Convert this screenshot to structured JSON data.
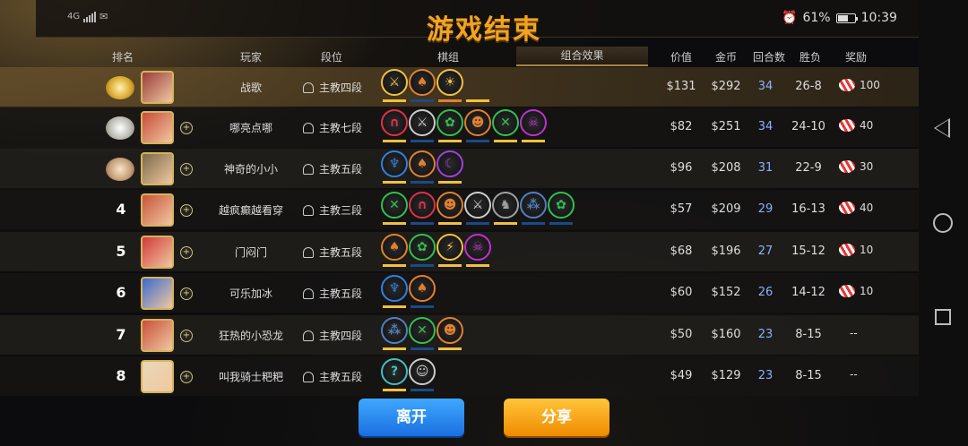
{
  "status": {
    "network": "4G",
    "battery": "61%",
    "battery_level": 0.61,
    "time": "10:39"
  },
  "title": "游戏结束",
  "headers": {
    "rank": "排名",
    "player": "玩家",
    "tier": "段位",
    "board": "棋组",
    "combo": "组合效果",
    "value": "价值",
    "gold": "金币",
    "rounds": "回合数",
    "wl": "胜负",
    "reward": "奖励"
  },
  "players": [
    {
      "rank": "1",
      "medal": "gold",
      "name": "战歌",
      "tier": "主教四段",
      "value": "$131",
      "gold": "$292",
      "rounds": "34",
      "wl": "26-8",
      "reward": "100",
      "me": true,
      "traits": [
        [
          "⚔",
          "#f0c040"
        ],
        [
          "♠",
          "#e08030"
        ],
        [
          "☀",
          "#f0c040"
        ]
      ],
      "bars": [
        "#f0c040",
        "#1a4a8a",
        "#e08030",
        "#f0c040"
      ]
    },
    {
      "rank": "2",
      "medal": "silver",
      "name": "哪亮点哪",
      "tier": "主教七段",
      "value": "$82",
      "gold": "$251",
      "rounds": "34",
      "wl": "24-10",
      "reward": "40",
      "me": false,
      "traits": [
        [
          "∩",
          "#e0304a"
        ],
        [
          "⚔",
          "#cccccc"
        ],
        [
          "✿",
          "#30c050"
        ],
        [
          "☻",
          "#e08030"
        ],
        [
          "✕",
          "#30c050"
        ],
        [
          "☠",
          "#c030d0"
        ]
      ],
      "bars": [
        "#f0c040",
        "#1a4a8a",
        "#f0c040",
        "#1a4a8a",
        "#f0c040",
        "#f0c040"
      ]
    },
    {
      "rank": "3",
      "medal": "bronze",
      "name": "神奇的小小",
      "tier": "主教五段",
      "value": "$96",
      "gold": "$208",
      "rounds": "31",
      "wl": "22-9",
      "reward": "30",
      "me": false,
      "traits": [
        [
          "♆",
          "#3080e0"
        ],
        [
          "♠",
          "#e08030"
        ],
        [
          "☾",
          "#a040e0"
        ]
      ],
      "bars": [
        "#f0c040",
        "#1a4a8a",
        "#f0c040"
      ]
    },
    {
      "rank": "4",
      "medal": "",
      "name": "越疯癫越看穿",
      "tier": "主教三段",
      "value": "$57",
      "gold": "$209",
      "rounds": "29",
      "wl": "16-13",
      "reward": "40",
      "me": false,
      "traits": [
        [
          "✕",
          "#30c050"
        ],
        [
          "∩",
          "#e0304a"
        ],
        [
          "☻",
          "#e08030"
        ],
        [
          "⚔",
          "#cccccc"
        ],
        [
          "♞",
          "#a0a0a0"
        ],
        [
          "⁂",
          "#5080c0"
        ],
        [
          "✿",
          "#30c050"
        ]
      ],
      "bars": [
        "#f0c040",
        "#1a4a8a",
        "#f0c040",
        "#1a4a8a",
        "#f0c040",
        "#1a4a8a",
        "#1a4a8a"
      ]
    },
    {
      "rank": "5",
      "medal": "",
      "name": "门闷门",
      "tier": "主教五段",
      "value": "$68",
      "gold": "$196",
      "rounds": "27",
      "wl": "15-12",
      "reward": "10",
      "me": false,
      "traits": [
        [
          "♠",
          "#e08030"
        ],
        [
          "✿",
          "#30c050"
        ],
        [
          "⚡",
          "#f0c040"
        ],
        [
          "☠",
          "#c030d0"
        ]
      ],
      "bars": [
        "#f0c040",
        "#1a4a8a",
        "#f0c040",
        "#f0c040"
      ]
    },
    {
      "rank": "6",
      "medal": "",
      "name": "可乐加冰",
      "tier": "主教五段",
      "value": "$60",
      "gold": "$152",
      "rounds": "26",
      "wl": "14-12",
      "reward": "10",
      "me": false,
      "traits": [
        [
          "♆",
          "#3080e0"
        ],
        [
          "♠",
          "#e08030"
        ]
      ],
      "bars": [
        "#f0c040",
        "#1a4a8a"
      ]
    },
    {
      "rank": "7",
      "medal": "",
      "name": "狂热的小恐龙",
      "tier": "主教四段",
      "value": "$50",
      "gold": "$160",
      "rounds": "23",
      "wl": "8-15",
      "reward": "--",
      "me": false,
      "traits": [
        [
          "⁂",
          "#5080c0"
        ],
        [
          "✕",
          "#30c050"
        ],
        [
          "☻",
          "#e08030"
        ]
      ],
      "bars": [
        "#f0c040",
        "#1a4a8a",
        "#f0c040"
      ]
    },
    {
      "rank": "8",
      "medal": "",
      "name": "叫我骑士粑粑",
      "tier": "主教五段",
      "value": "$49",
      "gold": "$129",
      "rounds": "23",
      "wl": "8-15",
      "reward": "--",
      "me": false,
      "traits": [
        [
          "?",
          "#40c0c0"
        ],
        [
          "☺",
          "#cccccc"
        ]
      ],
      "bars": [
        "#f0c040",
        "#1a4a8a"
      ]
    }
  ],
  "buttons": {
    "leave": "离开",
    "share": "分享"
  }
}
